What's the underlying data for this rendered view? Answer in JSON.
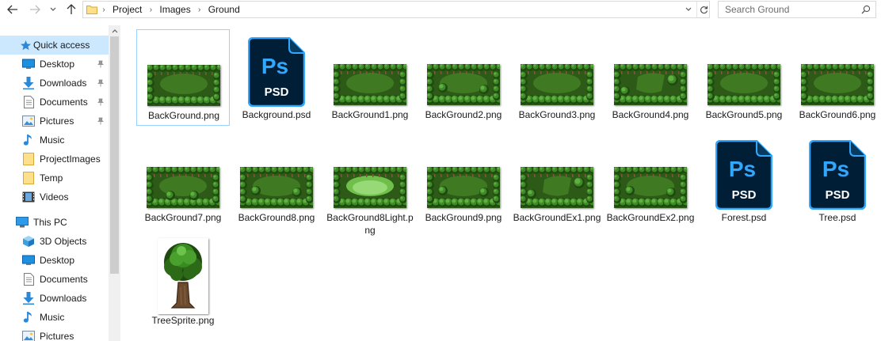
{
  "address": {
    "breadcrumbs": [
      "Project",
      "Images",
      "Ground"
    ]
  },
  "search": {
    "placeholder": "Search Ground"
  },
  "sidebar": {
    "items": [
      {
        "label": "Quick access",
        "icon": "star-icon",
        "selected": true,
        "pinned": false
      },
      {
        "label": "Desktop",
        "icon": "desktop-icon",
        "pinned": true
      },
      {
        "label": "Downloads",
        "icon": "download-icon",
        "pinned": true
      },
      {
        "label": "Documents",
        "icon": "documents-icon",
        "pinned": true
      },
      {
        "label": "Pictures",
        "icon": "pictures-icon",
        "pinned": true
      },
      {
        "label": "Music",
        "icon": "music-icon",
        "pinned": false
      },
      {
        "label": "ProjectImages",
        "icon": "folder-icon",
        "pinned": false
      },
      {
        "label": "Temp",
        "icon": "folder-icon",
        "pinned": false
      },
      {
        "label": "Videos",
        "icon": "videos-icon",
        "pinned": false
      },
      {
        "label": "This PC",
        "icon": "pc-icon",
        "pinned": false
      },
      {
        "label": "3D Objects",
        "icon": "3d-objects-icon",
        "pinned": false
      },
      {
        "label": "Desktop",
        "icon": "desktop-icon",
        "pinned": false
      },
      {
        "label": "Documents",
        "icon": "documents-icon",
        "pinned": false
      },
      {
        "label": "Downloads",
        "icon": "download-icon",
        "pinned": false
      },
      {
        "label": "Music",
        "icon": "music-icon",
        "pinned": false
      },
      {
        "label": "Pictures",
        "icon": "pictures-icon",
        "pinned": false
      }
    ]
  },
  "files": [
    {
      "name": "BackGround.png",
      "type": "png",
      "variant": "a",
      "selected": true
    },
    {
      "name": "Background.psd",
      "type": "psd"
    },
    {
      "name": "BackGround1.png",
      "type": "png",
      "variant": "a"
    },
    {
      "name": "BackGround2.png",
      "type": "png",
      "variant": "b"
    },
    {
      "name": "BackGround3.png",
      "type": "png",
      "variant": "a"
    },
    {
      "name": "BackGround4.png",
      "type": "png",
      "variant": "c"
    },
    {
      "name": "BackGround5.png",
      "type": "png",
      "variant": "a"
    },
    {
      "name": "BackGround6.png",
      "type": "png",
      "variant": "a"
    },
    {
      "name": "BackGround7.png",
      "type": "png",
      "variant": "d"
    },
    {
      "name": "BackGround8.png",
      "type": "png",
      "variant": "e"
    },
    {
      "name": "BackGround8Light.png",
      "type": "png",
      "variant": "f"
    },
    {
      "name": "BackGround9.png",
      "type": "png",
      "variant": "b"
    },
    {
      "name": "BackGroundEx1.png",
      "type": "png",
      "variant": "c"
    },
    {
      "name": "BackGroundEx2.png",
      "type": "png",
      "variant": "e"
    },
    {
      "name": "Forest.psd",
      "type": "psd"
    },
    {
      "name": "Tree.psd",
      "type": "psd"
    },
    {
      "name": "TreeSprite.png",
      "type": "sprite"
    }
  ],
  "colors": {
    "selection": "#cce8ff",
    "psd_blue": "#31a8ff",
    "psd_dark": "#001e36",
    "forest_dark": "#2c5417",
    "forest_light": "#4a8c2a"
  }
}
